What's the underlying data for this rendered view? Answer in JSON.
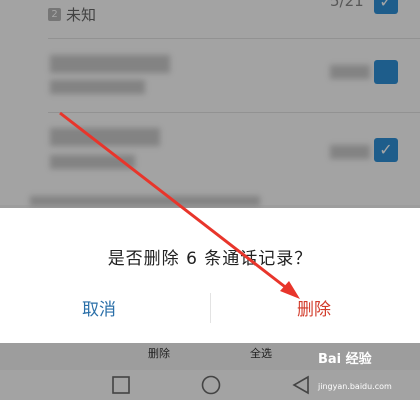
{
  "list": {
    "sim_badge": "2",
    "unknown_label": "未知",
    "count": "5/21"
  },
  "dialog": {
    "message": "是否删除 6 条通话记录？",
    "cancel_label": "取消",
    "delete_label": "删除"
  },
  "toolbar": {
    "delete_label": "删除",
    "select_all_label": "全选"
  },
  "watermark": {
    "brand": "Bai 经验",
    "url": "jingyan.baidu.com"
  },
  "colors": {
    "accent": "#2e90d6",
    "cancel": "#2a6fa8",
    "delete": "#d23b2a",
    "annotation_arrow": "#e8352b"
  }
}
